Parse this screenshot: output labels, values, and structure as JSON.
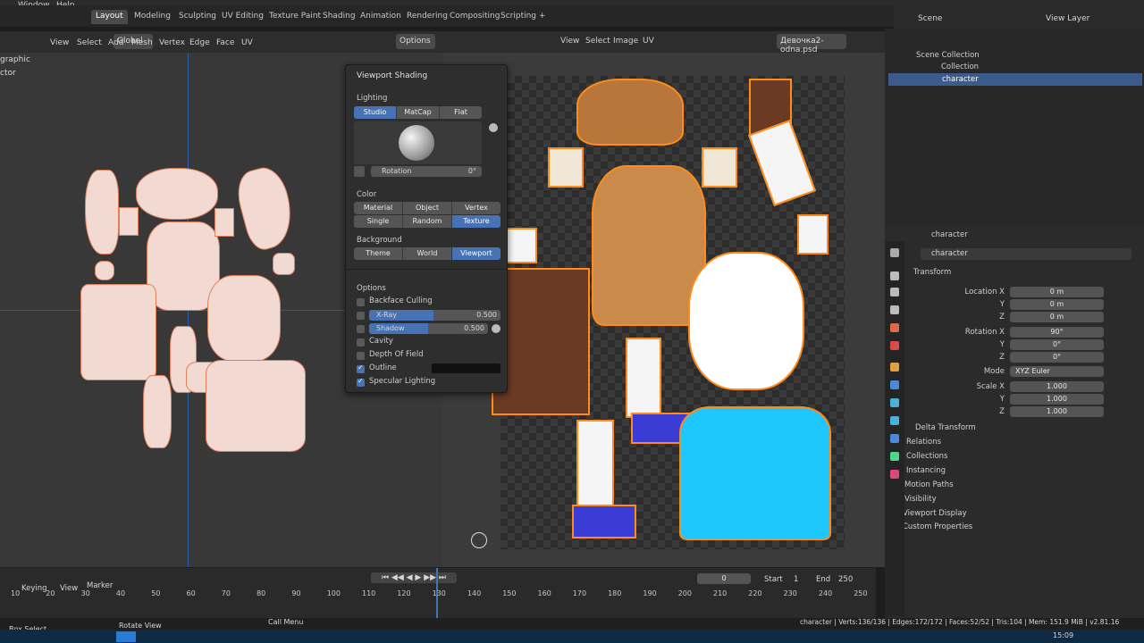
{
  "menu": {
    "items": [
      "Window",
      "Help"
    ]
  },
  "workspace_tabs": [
    {
      "label": "Layout",
      "active": true
    },
    {
      "label": "Modeling",
      "active": false
    },
    {
      "label": "Sculpting",
      "active": false
    },
    {
      "label": "UV Editing",
      "active": false
    },
    {
      "label": "Texture Paint",
      "active": false
    },
    {
      "label": "Shading",
      "active": false
    },
    {
      "label": "Animation",
      "active": false
    },
    {
      "label": "Rendering",
      "active": false
    },
    {
      "label": "Compositing",
      "active": false
    },
    {
      "label": "Scripting",
      "active": false
    }
  ],
  "add_tab": "+",
  "top_right": {
    "scene": "Scene",
    "view_layer": "View Layer"
  },
  "viewport3d": {
    "mode_label": "graphic",
    "transform_orientation": "Global",
    "options": "Options",
    "menus": [
      "View",
      "Select",
      "Add",
      "Mesh",
      "Vertex",
      "Edge",
      "Face",
      "UV"
    ],
    "left_text": "ctor"
  },
  "image_editor": {
    "menus": [
      "View",
      "Select",
      "Image",
      "UV"
    ],
    "image_name": "Девочка2-odna.psd"
  },
  "shading_popover": {
    "title": "Viewport Shading",
    "lighting": {
      "label": "Lighting",
      "options": [
        "Studio",
        "MatCap",
        "Flat"
      ],
      "selected": "Studio"
    },
    "rotation": {
      "label": "Rotation",
      "value": "0°"
    },
    "color": {
      "label": "Color",
      "options": [
        "Material",
        "Object",
        "Vertex",
        "Single",
        "Random",
        "Texture"
      ],
      "selected": "Texture"
    },
    "background": {
      "label": "Background",
      "options": [
        "Theme",
        "World",
        "Viewport"
      ],
      "selected": "Viewport"
    },
    "options_label": "Options",
    "checkboxes": [
      {
        "label": "Backface Culling",
        "checked": false
      },
      {
        "label": "X-Ray",
        "checked": false,
        "value": "0.500"
      },
      {
        "label": "Shadow",
        "checked": false,
        "value": "0.500"
      },
      {
        "label": "Cavity",
        "checked": false
      },
      {
        "label": "Depth Of Field",
        "checked": false
      },
      {
        "label": "Outline",
        "checked": true
      },
      {
        "label": "Specular Lighting",
        "checked": true
      }
    ]
  },
  "outliner": {
    "items": [
      {
        "label": "Scene Collection"
      },
      {
        "label": "Collection"
      },
      {
        "label": "character"
      }
    ]
  },
  "properties": {
    "object_name_header": "character",
    "object_name_field": "character",
    "transform_label": "Transform",
    "location": {
      "label": "Location X",
      "x": "0 m",
      "y": "0 m",
      "z": "0 m"
    },
    "rotation": {
      "label": "Rotation X",
      "x": "90°",
      "y": "0°",
      "z": "0°"
    },
    "mode": {
      "label": "Mode",
      "value": "XYZ Euler"
    },
    "scale": {
      "label": "Scale X",
      "x": "1.000",
      "y": "1.000",
      "z": "1.000"
    },
    "axis_y": "Y",
    "axis_z": "Z",
    "subpanels": [
      "Delta Transform",
      "Relations",
      "Collections",
      "Instancing",
      "Motion Paths",
      "Visibility",
      "Viewport Display",
      "Custom Properties"
    ]
  },
  "timeline": {
    "menus": [
      "Keying",
      "View",
      "Marker"
    ],
    "current_frame": "0",
    "start_label": "Start",
    "start": "1",
    "end_label": "End",
    "end": "250",
    "ticks": [
      "10",
      "20",
      "30",
      "40",
      "50",
      "60",
      "70",
      "80",
      "90",
      "100",
      "110",
      "120",
      "130",
      "140",
      "150",
      "160",
      "170",
      "180",
      "190",
      "200",
      "210",
      "220",
      "230",
      "240",
      "250"
    ]
  },
  "statusbar": {
    "box_select": "Box Select",
    "rotate_view": "Rotate View",
    "call_menu": "Call Menu",
    "stats": "character | Verts:136/136 | Edges:172/172 | Faces:52/52 | Tris:104 | Mem: 151.9 MiB | v2.81.16"
  },
  "taskbar": {
    "time": "15:09"
  }
}
